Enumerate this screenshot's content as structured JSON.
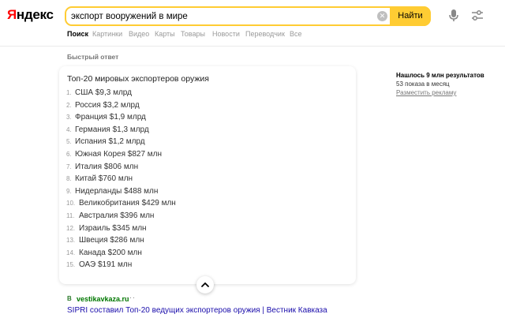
{
  "header": {
    "logo": "Яндекс",
    "search_value": "экспорт вооружений в мире",
    "search_button": "Найти"
  },
  "tabs": [
    "Поиск",
    "Картинки",
    "Видео",
    "Карты",
    "Товары",
    "Новости",
    "Переводчик",
    "Все"
  ],
  "quick_answer": {
    "label": "Быстрый ответ",
    "title": "Топ-20 мировых экспортеров оружия",
    "items": [
      {
        "num": "1.",
        "text": "США $9,3 млрд"
      },
      {
        "num": "2.",
        "text": "Россия $3,2 млрд"
      },
      {
        "num": "3.",
        "text": "Франция $1,9 млрд"
      },
      {
        "num": "4.",
        "text": "Германия $1,3 млрд"
      },
      {
        "num": "5.",
        "text": "Испания $1,2 млрд"
      },
      {
        "num": "6.",
        "text": "Южная Корея $827 млн"
      },
      {
        "num": "7.",
        "text": "Италия $806 млн"
      },
      {
        "num": "8.",
        "text": "Китай $760 млн"
      },
      {
        "num": "9.",
        "text": "Нидерланды $488 млн"
      },
      {
        "num": "10.",
        "text": "Великобритания $429 млн"
      },
      {
        "num": "11.",
        "text": "Австралия $396 млн"
      },
      {
        "num": "12.",
        "text": "Израиль $345 млн"
      },
      {
        "num": "13.",
        "text": "Швеция $286 млн"
      },
      {
        "num": "14.",
        "text": "Канада $200 млн"
      },
      {
        "num": "15.",
        "text": "ОАЭ $191 млн"
      }
    ]
  },
  "source": {
    "domain": "vestikavkaza.ru",
    "more": "···",
    "title": "SIPRI составил Топ-20 ведущих экспортеров оружия | Вестник Кавказа"
  },
  "sidebar": {
    "found": "Нашлось 9 млн результатов",
    "shows": "53 показа в месяц",
    "place_ad": "Разместить рекламу"
  },
  "colors": {
    "accent": "#ffcc33",
    "logo_red": "#ff0000",
    "link": "#1a0dab",
    "domain": "#007700"
  }
}
